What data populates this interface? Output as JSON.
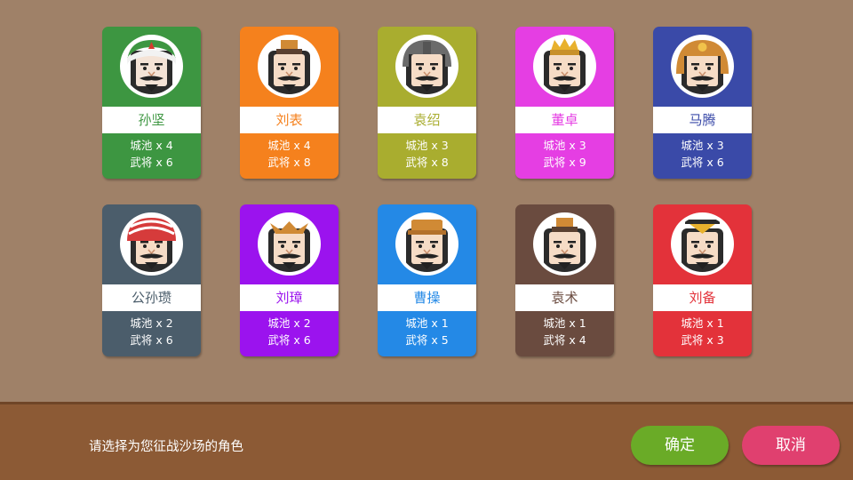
{
  "cards": [
    {
      "name": "孙坚",
      "cities": "城池 x 4",
      "generals": "武将 x 6",
      "color": "#3d9641",
      "name_color": "#3d9641",
      "headgear": "turban-green",
      "skin": "#f4e3d6"
    },
    {
      "name": "刘表",
      "cities": "城池 x 4",
      "generals": "武将 x 8",
      "color": "#f5811d",
      "name_color": "#f5811d",
      "headgear": "crown-small",
      "skin": "#f6dcc6"
    },
    {
      "name": "袁绍",
      "cities": "城池 x 3",
      "generals": "武将 x 8",
      "color": "#a9ad2f",
      "name_color": "#a9ad2f",
      "headgear": "helmet-gray",
      "skin": "#f6dcc6"
    },
    {
      "name": "董卓",
      "cities": "城池 x 3",
      "generals": "武将 x 9",
      "color": "#e53ee3",
      "name_color": "#e53ee3",
      "headgear": "crown-gold",
      "skin": "#f6dcc6"
    },
    {
      "name": "马腾",
      "cities": "城池 x 3",
      "generals": "武将 x 6",
      "color": "#3a4aa8",
      "name_color": "#3a4aa8",
      "headgear": "helmet-gold",
      "skin": "#f6dcc6"
    },
    {
      "name": "公孙瓒",
      "cities": "城池 x 2",
      "generals": "武将 x 6",
      "color": "#4b5d6b",
      "name_color": "#4b5d6b",
      "headgear": "turban-red",
      "skin": "#f6dcc6"
    },
    {
      "name": "刘璋",
      "cities": "城池 x 2",
      "generals": "武将 x 6",
      "color": "#9b13ee",
      "name_color": "#9b13ee",
      "headgear": "crown-wing",
      "skin": "#f6dcc6"
    },
    {
      "name": "曹操",
      "cities": "城池 x 1",
      "generals": "武将 x 5",
      "color": "#2489e6",
      "name_color": "#2489e6",
      "headgear": "hat-official",
      "skin": "#f6dcc6"
    },
    {
      "name": "袁术",
      "cities": "城池 x 1",
      "generals": "武将 x 4",
      "color": "#6a4b3f",
      "name_color": "#6a4b3f",
      "headgear": "crown-small",
      "skin": "#f6dcc6"
    },
    {
      "name": "刘备",
      "cities": "城池 x 1",
      "generals": "武将 x 3",
      "color": "#e3323a",
      "name_color": "#e3323a",
      "headgear": "hat-tri",
      "skin": "#f6dcc6"
    }
  ],
  "footer": {
    "prompt": "请选择为您征战沙场的角色",
    "confirm": "确定",
    "cancel": "取消"
  }
}
